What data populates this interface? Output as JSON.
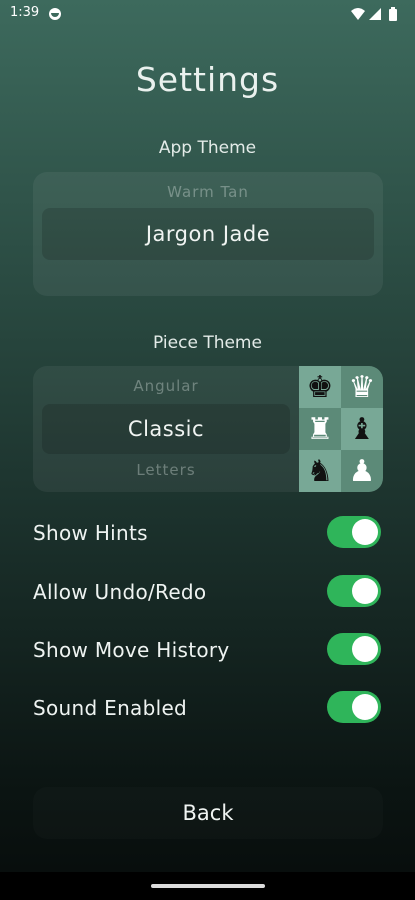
{
  "status_bar": {
    "time": "1:39"
  },
  "title": "Settings",
  "app_theme": {
    "label": "App Theme",
    "options_visible": [
      "Warm Tan",
      "Jargon Jade"
    ],
    "selected": "Jargon Jade"
  },
  "piece_theme": {
    "label": "Piece Theme",
    "option_above": "Angular",
    "selected": "Classic",
    "option_below": "Letters",
    "preview_glyphs": [
      "♚",
      "♛",
      "♜",
      "♝",
      "♞",
      "♟"
    ]
  },
  "toggles": [
    {
      "label": "Show Hints",
      "on": true
    },
    {
      "label": "Allow Undo/Redo",
      "on": true
    },
    {
      "label": "Show Move History",
      "on": true
    },
    {
      "label": "Sound Enabled",
      "on": true
    }
  ],
  "back_label": "Back",
  "colors": {
    "toggle_on": "#2fb55a",
    "board_light": "#78a896",
    "board_dark": "#5c8a78"
  }
}
